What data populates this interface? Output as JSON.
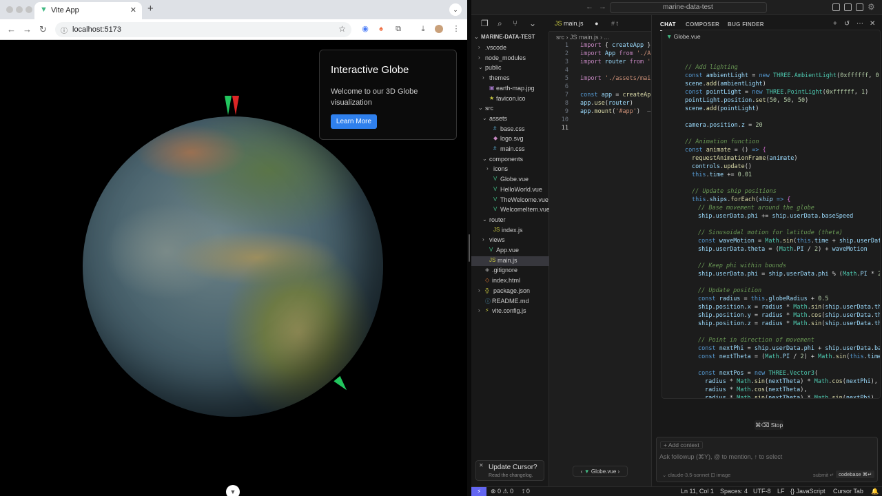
{
  "browser": {
    "tab_title": "Vite App",
    "tab_close": "✕",
    "new_tab": "+",
    "url": "localhost:5173",
    "card": {
      "title": "Interactive Globe",
      "text": "Welcome to our 3D Globe visualization",
      "button": "Learn More"
    }
  },
  "ide": {
    "command_center": "marine-data-test",
    "explorer": {
      "root": "MARINE-DATA-TEST",
      "items": [
        {
          "label": ".vscode",
          "arrow": "›",
          "indent": 1,
          "icon": ""
        },
        {
          "label": "node_modules",
          "arrow": "›",
          "indent": 1,
          "icon": ""
        },
        {
          "label": "public",
          "arrow": "⌄",
          "indent": 1,
          "icon": ""
        },
        {
          "label": "themes",
          "arrow": "›",
          "indent": 2,
          "icon": ""
        },
        {
          "label": "earth-map.jpg",
          "arrow": "",
          "indent": 2,
          "icon": "▣"
        },
        {
          "label": "favicon.ico",
          "arrow": "",
          "indent": 2,
          "icon": "★"
        },
        {
          "label": "src",
          "arrow": "⌄",
          "indent": 1,
          "icon": ""
        },
        {
          "label": "assets",
          "arrow": "⌄",
          "indent": 2,
          "icon": ""
        },
        {
          "label": "base.css",
          "arrow": "",
          "indent": 3,
          "icon": "#"
        },
        {
          "label": "logo.svg",
          "arrow": "",
          "indent": 3,
          "icon": "◆"
        },
        {
          "label": "main.css",
          "arrow": "",
          "indent": 3,
          "icon": "#"
        },
        {
          "label": "components",
          "arrow": "⌄",
          "indent": 2,
          "icon": ""
        },
        {
          "label": "icons",
          "arrow": "›",
          "indent": 3,
          "icon": ""
        },
        {
          "label": "Globe.vue",
          "arrow": "",
          "indent": 3,
          "icon": "V"
        },
        {
          "label": "HelloWorld.vue",
          "arrow": "",
          "indent": 3,
          "icon": "V"
        },
        {
          "label": "TheWelcome.vue",
          "arrow": "",
          "indent": 3,
          "icon": "V"
        },
        {
          "label": "WelcomeItem.vue",
          "arrow": "",
          "indent": 3,
          "icon": "V"
        },
        {
          "label": "router",
          "arrow": "⌄",
          "indent": 2,
          "icon": ""
        },
        {
          "label": "index.js",
          "arrow": "",
          "indent": 3,
          "icon": "JS"
        },
        {
          "label": "views",
          "arrow": "›",
          "indent": 2,
          "icon": ""
        },
        {
          "label": "App.vue",
          "arrow": "",
          "indent": 2,
          "icon": "V"
        },
        {
          "label": "main.js",
          "arrow": "",
          "indent": 2,
          "icon": "JS",
          "selected": true
        },
        {
          "label": ".gitignore",
          "arrow": "",
          "indent": 1,
          "icon": "◈"
        },
        {
          "label": "index.html",
          "arrow": "",
          "indent": 1,
          "icon": "◇"
        },
        {
          "label": "package.json",
          "arrow": "›",
          "indent": 1,
          "icon": "{}"
        },
        {
          "label": "README.md",
          "arrow": "",
          "indent": 1,
          "icon": "ⓘ"
        },
        {
          "label": "vite.config.js",
          "arrow": "›",
          "indent": 1,
          "icon": "⚡"
        }
      ]
    },
    "editor": {
      "tab_active": "main.js",
      "tab_dot": "●",
      "tab_second": "# t",
      "breadcrumb": "src  ›  JS main.js  › ...",
      "minitab": "Globe.vue"
    },
    "chat": {
      "tabs": [
        "CHAT",
        "COMPOSER",
        "BUG FINDER"
      ],
      "file": "Globe.vue",
      "stop": "⌘⌫ Stop",
      "add_context": "+ Add context",
      "placeholder": "Ask followup (⌘Y), @ to mention, ↑ to select",
      "model": "⌄ claude-3.5-sonnet   ⊡ image",
      "submit": "submit ↵",
      "codebase": "codebase ⌘↵"
    },
    "toast": {
      "title": "Update Cursor?",
      "subtitle": "Read the changelog."
    },
    "status": {
      "problems": "⊗ 0 ⚠ 0",
      "ports": "⟟ 0",
      "position": "Ln 11, Col 1",
      "spaces": "Spaces: 4",
      "encoding": "UTF-8",
      "eol": "LF",
      "language": "{} JavaScript",
      "cursor_tab": "Cursor Tab"
    }
  }
}
